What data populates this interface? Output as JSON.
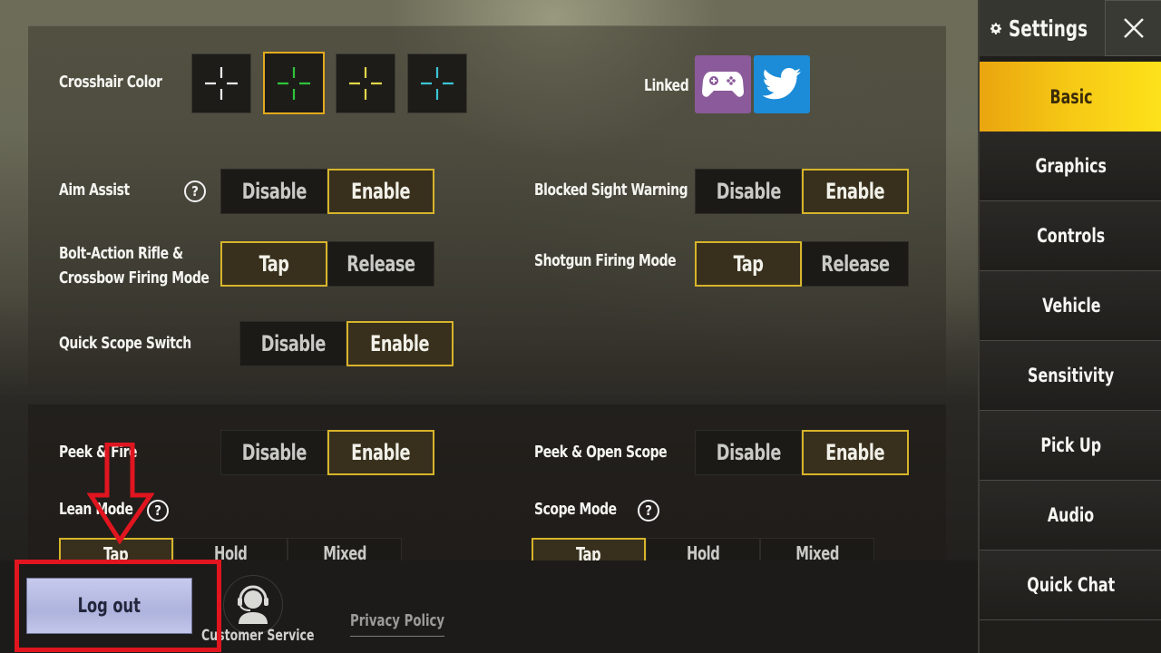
{
  "sidebar": {
    "title": "Settings",
    "title_icon": "gear-icon",
    "close_icon": "close-icon",
    "items": [
      {
        "label": "Basic",
        "active": true
      },
      {
        "label": "Graphics"
      },
      {
        "label": "Controls"
      },
      {
        "label": "Vehicle"
      },
      {
        "label": "Sensitivity"
      },
      {
        "label": "Pick Up"
      },
      {
        "label": "Audio"
      },
      {
        "label": "Quick Chat"
      }
    ]
  },
  "basic": {
    "crosshair": {
      "label": "Crosshair Color",
      "options": [
        {
          "name": "white",
          "color": "#f0f0f0"
        },
        {
          "name": "green",
          "color": "#2fc43a",
          "selected": true
        },
        {
          "name": "yellow",
          "color": "#e2d64a"
        },
        {
          "name": "cyan",
          "color": "#3cc4d4"
        }
      ]
    },
    "linked": {
      "label": "Linked",
      "accounts": [
        {
          "name": "game-center",
          "icon": "gamepad-icon",
          "color": "#8a5a9a"
        },
        {
          "name": "twitter",
          "icon": "twitter-bird-icon",
          "color": "#1c8cd8"
        }
      ]
    },
    "settings": {
      "aim_assist": {
        "label": "Aim Assist",
        "options": [
          "Disable",
          "Enable"
        ],
        "selected": "Enable",
        "help": "?"
      },
      "blocked_sight_warning": {
        "label": "Blocked Sight Warning",
        "options": [
          "Disable",
          "Enable"
        ],
        "selected": "Enable"
      },
      "bolt_action": {
        "label_line1": "Bolt-Action Rifle &",
        "label_line2": "Crossbow Firing Mode",
        "options": [
          "Tap",
          "Release"
        ],
        "selected": "Tap"
      },
      "shotgun_firing_mode": {
        "label": "Shotgun Firing Mode",
        "options": [
          "Tap",
          "Release"
        ],
        "selected": "Tap"
      },
      "quick_scope_switch": {
        "label": "Quick Scope Switch",
        "options": [
          "Disable",
          "Enable"
        ],
        "selected": "Enable"
      },
      "peek_fire": {
        "label": "Peek & Fire",
        "options": [
          "Disable",
          "Enable"
        ],
        "selected": "Enable"
      },
      "peek_open_scope": {
        "label": "Peek & Open Scope",
        "options": [
          "Disable",
          "Enable"
        ],
        "selected": "Enable"
      },
      "lean_mode": {
        "label": "Lean Mode",
        "options": [
          "Tap",
          "Hold",
          "Mixed"
        ],
        "selected": "Tap",
        "help": "?"
      },
      "scope_mode": {
        "label": "Scope Mode",
        "options": [
          "Tap",
          "Hold",
          "Mixed"
        ],
        "selected": "Tap",
        "help": "?"
      }
    }
  },
  "footer": {
    "logout_label": "Log out",
    "customer_service_label": "Customer Service",
    "privacy_policy_label": "Privacy Policy"
  },
  "annotation": {
    "highlight_color": "#e0151f",
    "target": "Log out"
  }
}
